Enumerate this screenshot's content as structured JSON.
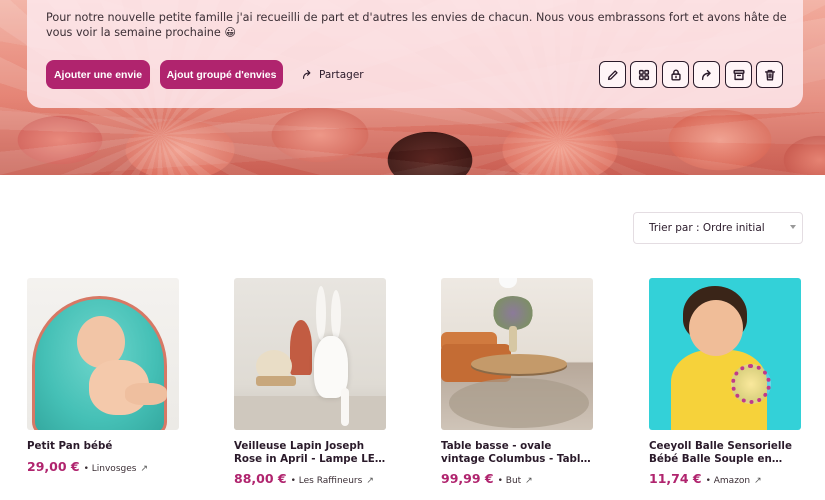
{
  "list": {
    "description": "Pour notre nouvelle petite famille j'ai recueilli de part et d'autres les envies de chacun. Nous vous embrassons fort et avons hâte de vous voir la semaine prochaine 😀",
    "add_wish_label": "Ajouter une envie",
    "group_add_label": "Ajout groupé d'envies",
    "share_label": "Partager",
    "actions": [
      "pencil-icon",
      "grid-icon",
      "lock-icon",
      "share-icon",
      "archive-icon",
      "trash-icon"
    ]
  },
  "sort": {
    "label": "Trier par : Ordre initial"
  },
  "products": [
    {
      "title": "Petit Pan bébé",
      "price": "29,00 €",
      "store": "• Linvosges",
      "arrow": "↗"
    },
    {
      "title": "Veilleuse Lapin Joseph Rose in April - Lampe LED Bébé | Lumière douce",
      "price": "88,00 €",
      "store": "• Les Raffineurs",
      "arrow": "↗"
    },
    {
      "title": "Table basse - ovale vintage Columbus - Table basse BUT",
      "price": "99,99 €",
      "store": "• But",
      "arrow": "↗"
    },
    {
      "title": "Ceeyoll Balle Sensorielle Bébé Balle Souple en Silicone Oball Bébé",
      "price": "11,74 €",
      "store": "• Amazon",
      "arrow": "↗"
    }
  ],
  "colors": {
    "accent": "#b0246e",
    "text": "#2a1a2a"
  }
}
